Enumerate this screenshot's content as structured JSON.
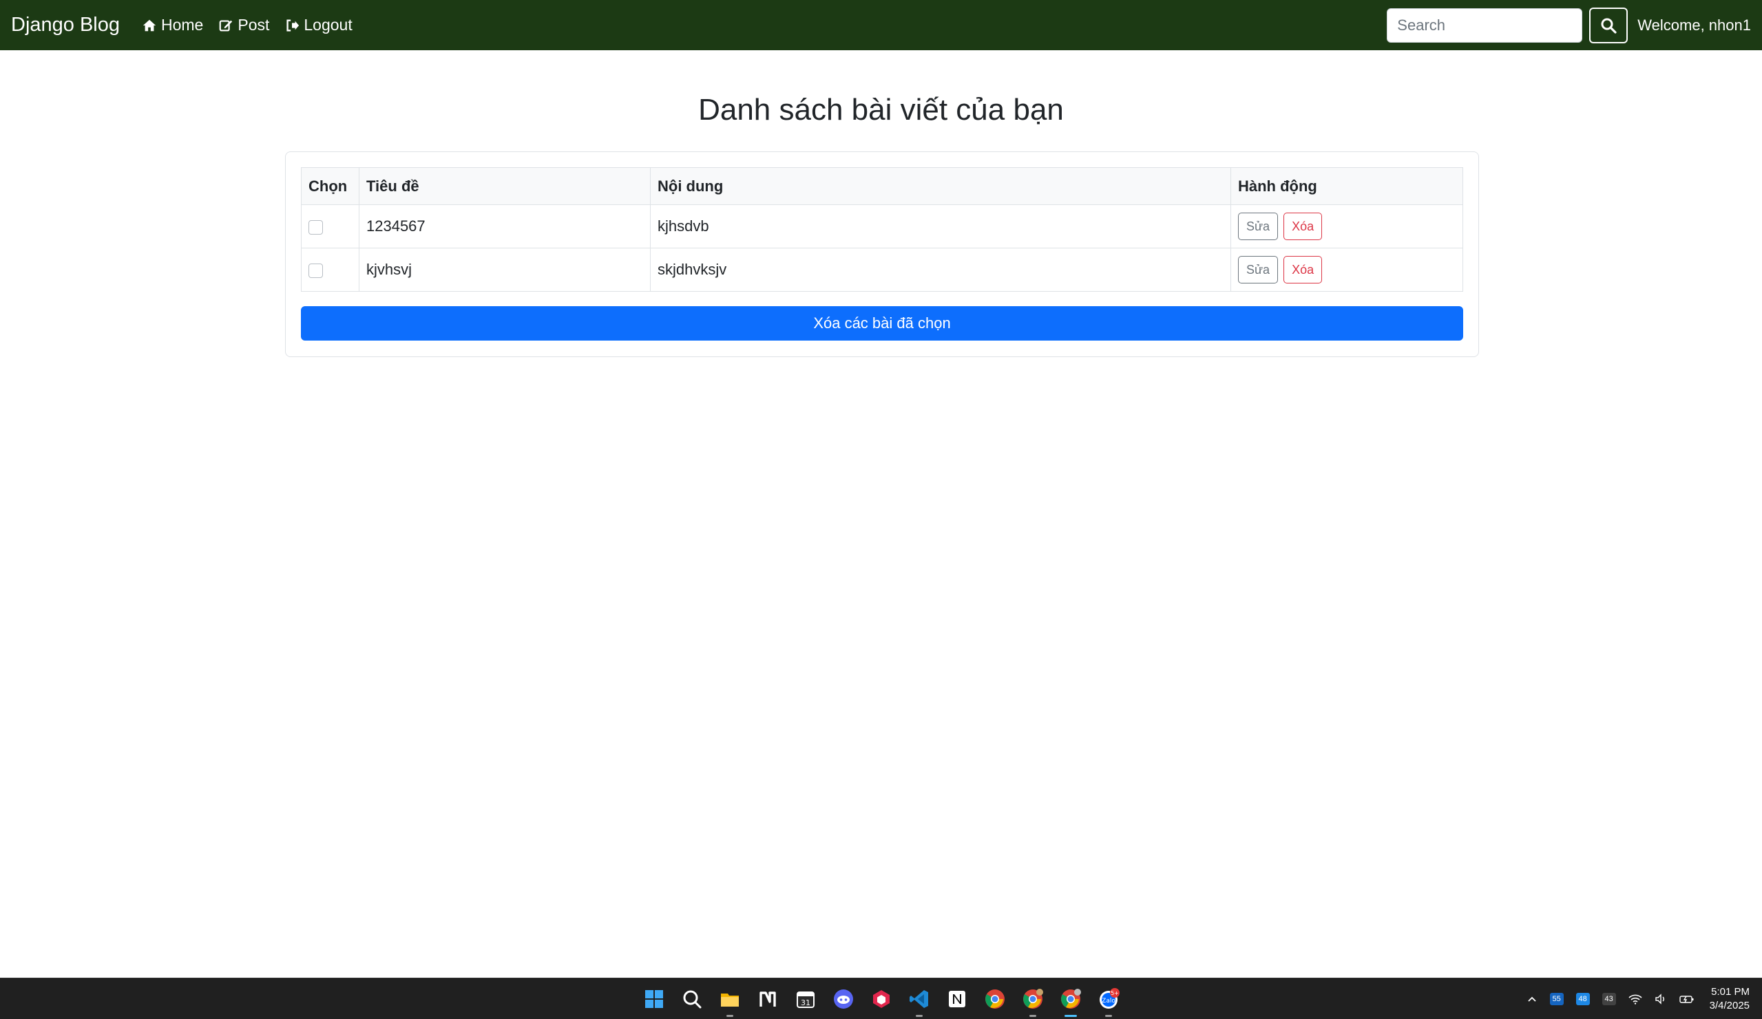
{
  "navbar": {
    "brand": "Django Blog",
    "links": [
      {
        "label": "Home",
        "icon": "home-icon"
      },
      {
        "label": "Post",
        "icon": "edit-icon"
      },
      {
        "label": "Logout",
        "icon": "logout-icon"
      }
    ],
    "search_placeholder": "Search",
    "welcome": "Welcome, nhon1"
  },
  "page": {
    "title": "Danh sách bài viết của bạn",
    "table": {
      "headers": [
        "Chọn",
        "Tiêu đề",
        "Nội dung",
        "Hành động"
      ],
      "rows": [
        {
          "title": "1234567",
          "content": "kjhsdvb",
          "checked": false
        },
        {
          "title": "kjvhsvj",
          "content": "skjdhvksjv",
          "checked": false
        }
      ],
      "edit_label": "Sửa",
      "delete_label": "Xóa"
    },
    "bulk_delete_label": "Xóa các bài đã chọn"
  },
  "taskbar": {
    "apps": [
      "windows-start-icon",
      "search-icon",
      "file-explorer-icon",
      "notion-calendar-icon",
      "calendar-icon",
      "discord-icon",
      "app-hexagon-icon",
      "vscode-icon",
      "notion-icon",
      "chrome-icon",
      "chrome-profile-icon",
      "chrome-profile-active-icon",
      "zalo-icon"
    ],
    "zalo_badge": "5+",
    "tray_badges": [
      "55",
      "48",
      "43"
    ],
    "time": "5:01 PM",
    "date": "3/4/2025"
  },
  "colors": {
    "navbar_bg": "#1c3a14",
    "primary": "#0d6efd",
    "danger": "#dc3545",
    "secondary": "#6c757d"
  }
}
